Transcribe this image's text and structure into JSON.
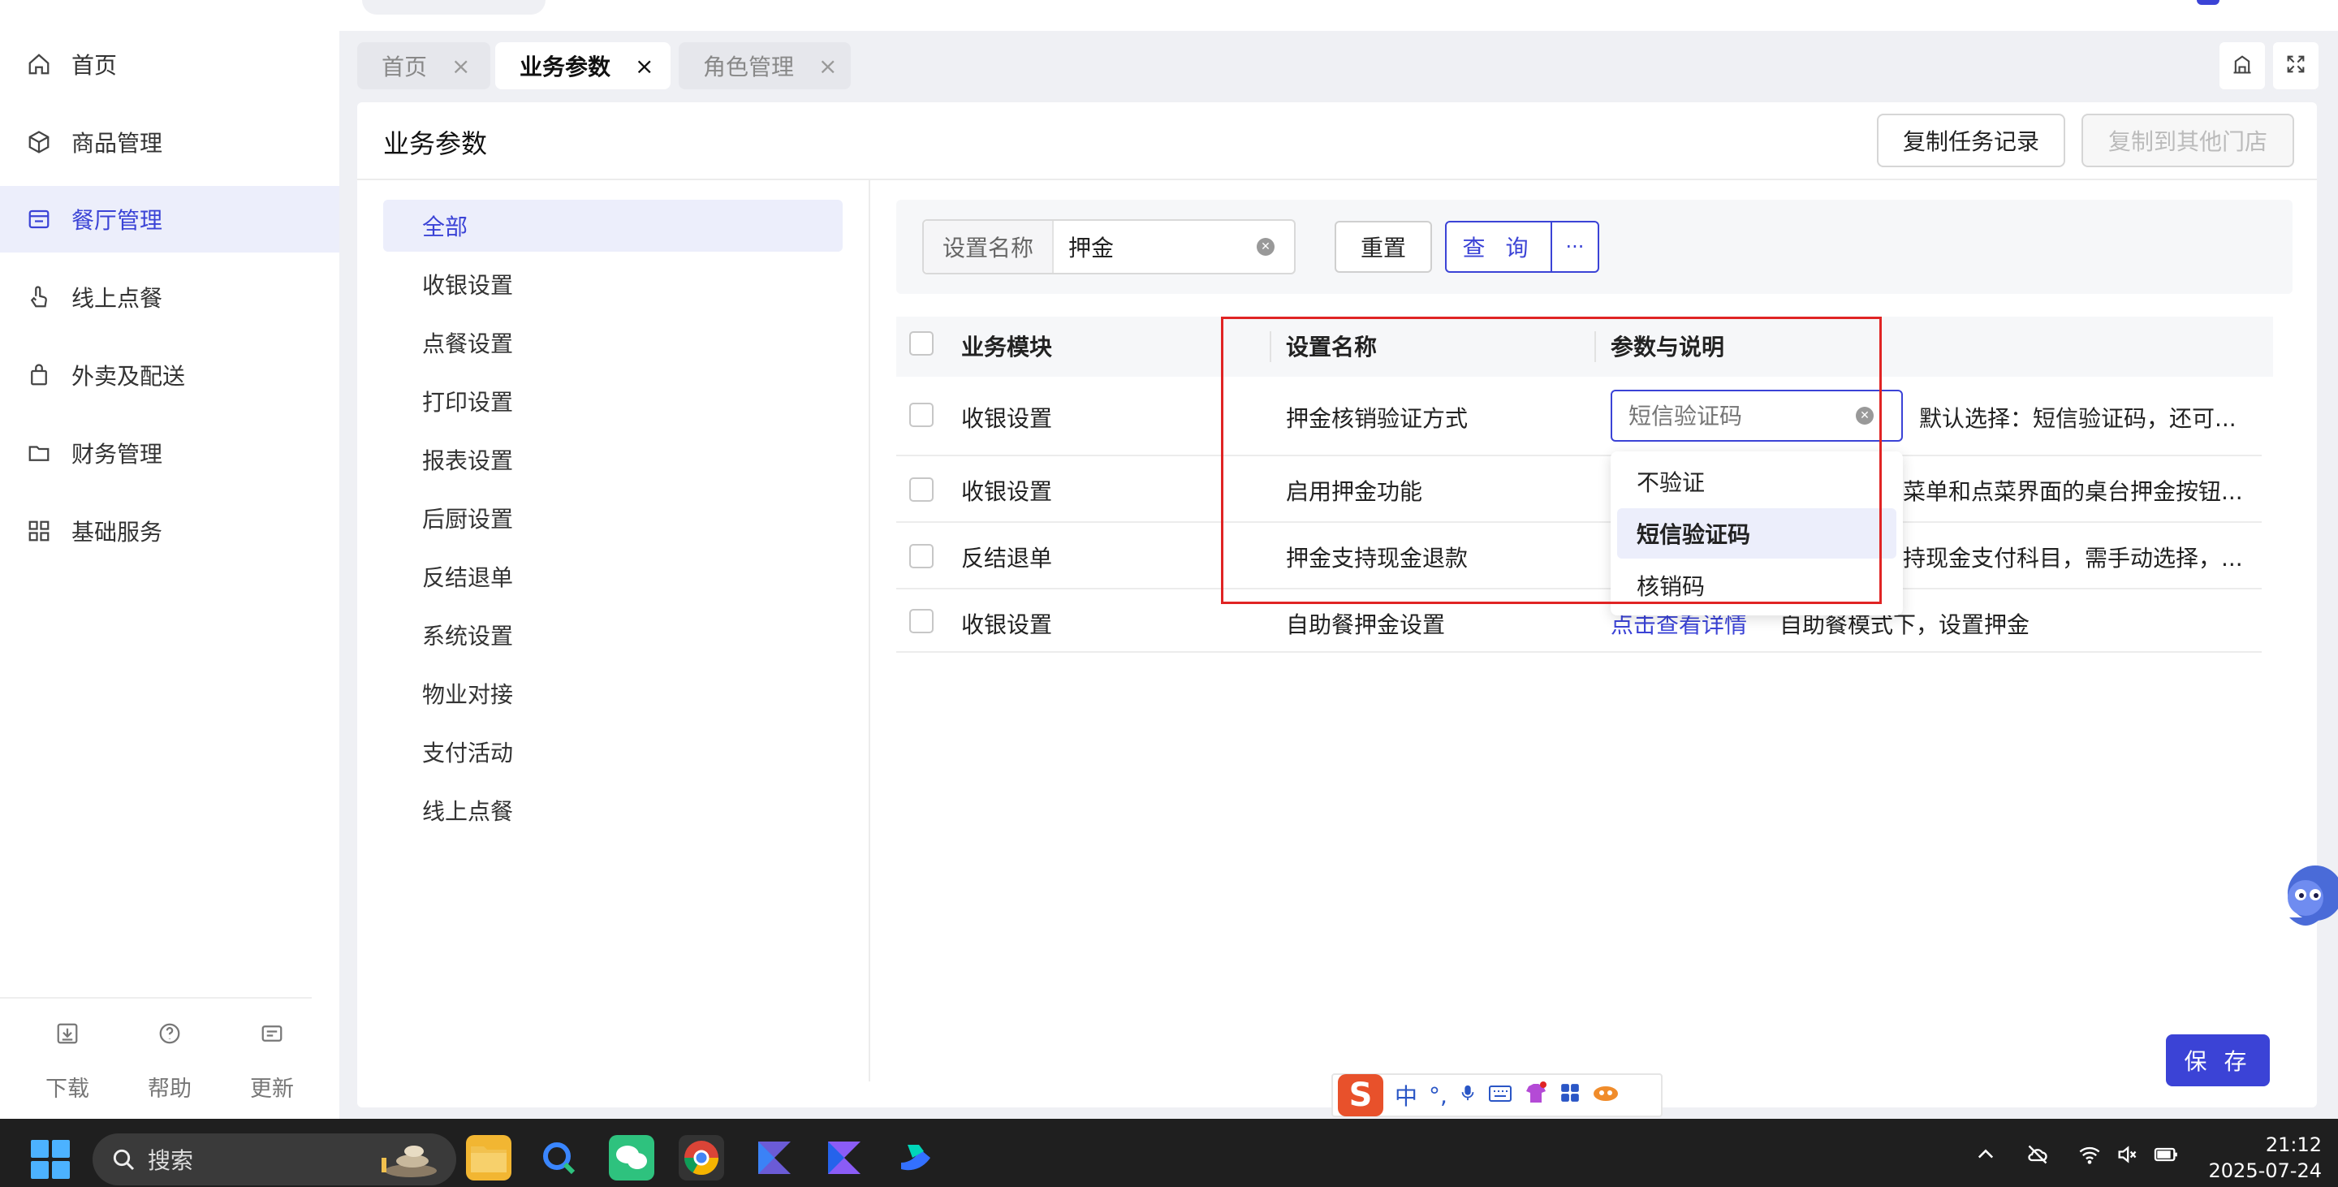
{
  "sidebar": {
    "items": [
      {
        "label": "首页",
        "icon": "home-icon"
      },
      {
        "label": "商品管理",
        "icon": "box-icon"
      },
      {
        "label": "餐厅管理",
        "icon": "store-icon",
        "active": true
      },
      {
        "label": "线上点餐",
        "icon": "hand-pointer-icon"
      },
      {
        "label": "外卖及配送",
        "icon": "bag-icon"
      },
      {
        "label": "财务管理",
        "icon": "folder-icon"
      },
      {
        "label": "基础服务",
        "icon": "grid-icon"
      }
    ],
    "bottom": [
      {
        "label": "下载",
        "icon": "download-icon"
      },
      {
        "label": "帮助",
        "icon": "help-icon"
      },
      {
        "label": "更新",
        "icon": "update-icon"
      }
    ]
  },
  "tabs": [
    {
      "label": "首页",
      "close": "×"
    },
    {
      "label": "业务参数",
      "close": "×",
      "active": true
    },
    {
      "label": "角色管理",
      "close": "×"
    }
  ],
  "header": {
    "title": "业务参数",
    "copy_task_label": "复制任务记录",
    "copy_store_label": "复制到其他门店"
  },
  "categories": [
    "全部",
    "收银设置",
    "点餐设置",
    "打印设置",
    "报表设置",
    "后厨设置",
    "反结退单",
    "系统设置",
    "物业对接",
    "支付活动",
    "线上点餐"
  ],
  "filter": {
    "label": "设置名称",
    "value": "押金",
    "reset_label": "重置",
    "query_label": "查 询",
    "more_label": "···"
  },
  "table": {
    "headers": [
      "业务模块",
      "设置名称",
      "参数与说明"
    ],
    "rows": [
      {
        "module": "收银设置",
        "name": "押金核销验证方式",
        "param": "",
        "desc": "默认选择：短信验证码，还可..."
      },
      {
        "module": "收银设置",
        "name": "启用押金功能",
        "param": "",
        "desc": "菜单和点菜界面的桌台押金按钮..."
      },
      {
        "module": "反结退单",
        "name": "押金支持现金退款",
        "param": "",
        "desc": "持现金支付科目，需手动选择，..."
      },
      {
        "module": "收银设置",
        "name": "自助餐押金设置",
        "param": "点击查看详情",
        "desc": "自助餐模式下，设置押金"
      }
    ]
  },
  "select": {
    "placeholder": "短信验证码",
    "options": [
      "不验证",
      "短信验证码",
      "核销码"
    ],
    "selected_index": 1
  },
  "save_label": "保 存",
  "ime": {
    "logo": "S",
    "mode": "中",
    "punct": "°,"
  },
  "taskbar": {
    "search_placeholder": "搜索",
    "time": "21:12",
    "date": "2025-07-24"
  },
  "colors": {
    "accent": "#3b43d6",
    "highlight": "#e02424"
  }
}
